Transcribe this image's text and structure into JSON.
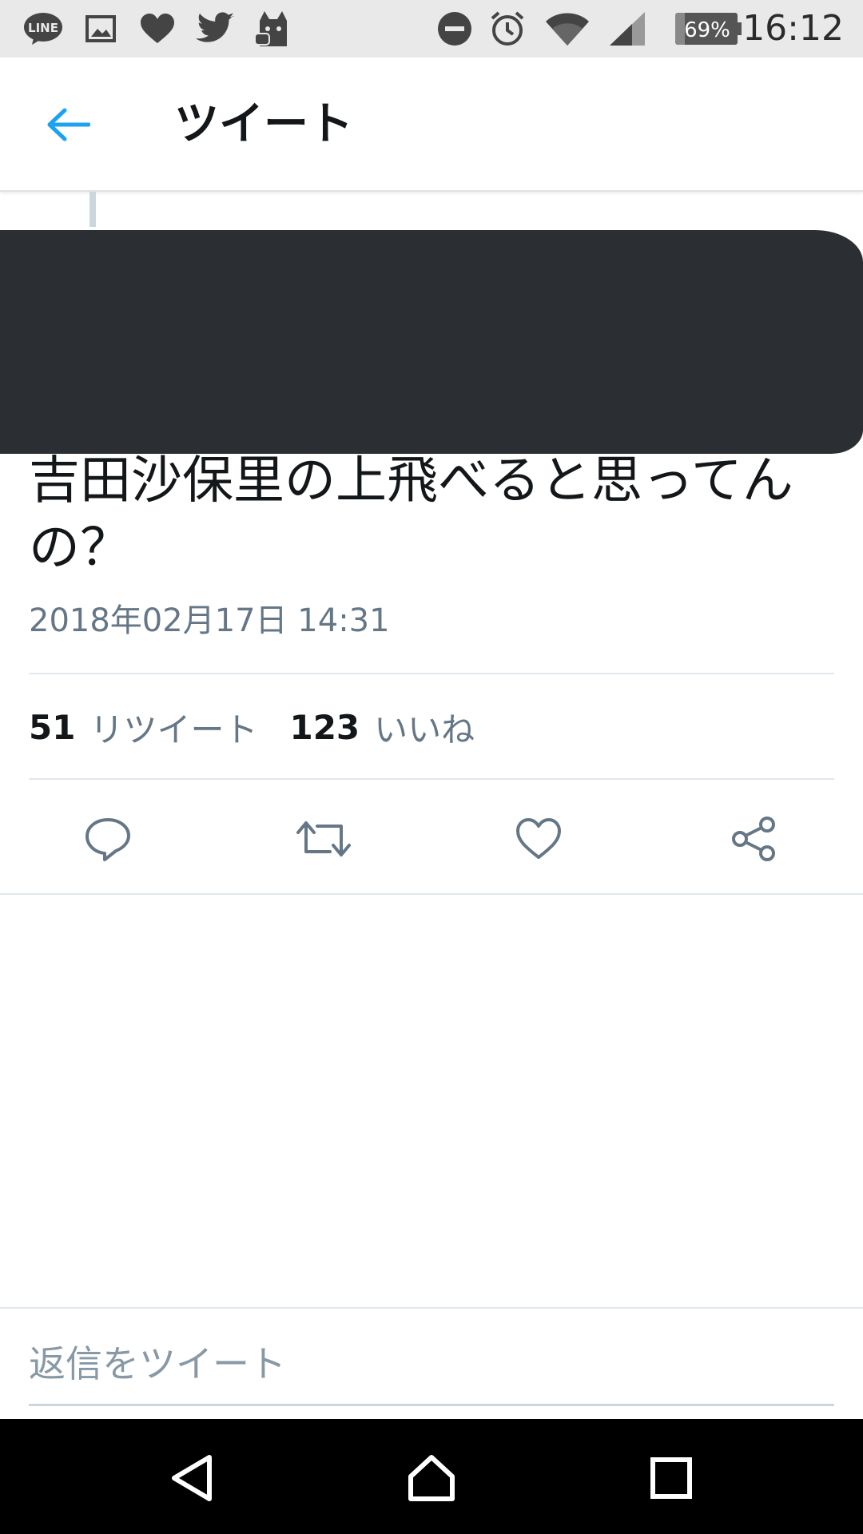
{
  "status_bar": {
    "time": "16:12",
    "battery": "69%",
    "notification_icons": [
      "line-icon",
      "image-icon",
      "heart-icon",
      "twitter-icon",
      "cat-app-icon"
    ],
    "system_icons": [
      "do-not-disturb-icon",
      "alarm-icon",
      "wifi-icon",
      "signal-icon",
      "battery-icon"
    ]
  },
  "header": {
    "title": "ツイート",
    "back_icon": "back-arrow-icon"
  },
  "tweet": {
    "text": "吉田沙保里の上飛べると思ってんの？",
    "date": "2018年02月17日 14:31",
    "retweet_count": "51",
    "retweet_label": "リツイート",
    "like_count": "123",
    "like_label": "いいね"
  },
  "actions": [
    "reply-icon",
    "retweet-icon",
    "like-icon",
    "share-icon"
  ],
  "reply": {
    "placeholder": "返信をツイート"
  },
  "colors": {
    "accent": "#1da1f2",
    "text": "#14171a",
    "secondary_text": "#657786",
    "divider": "#e1e8ed",
    "redaction": "#2b2f33"
  }
}
